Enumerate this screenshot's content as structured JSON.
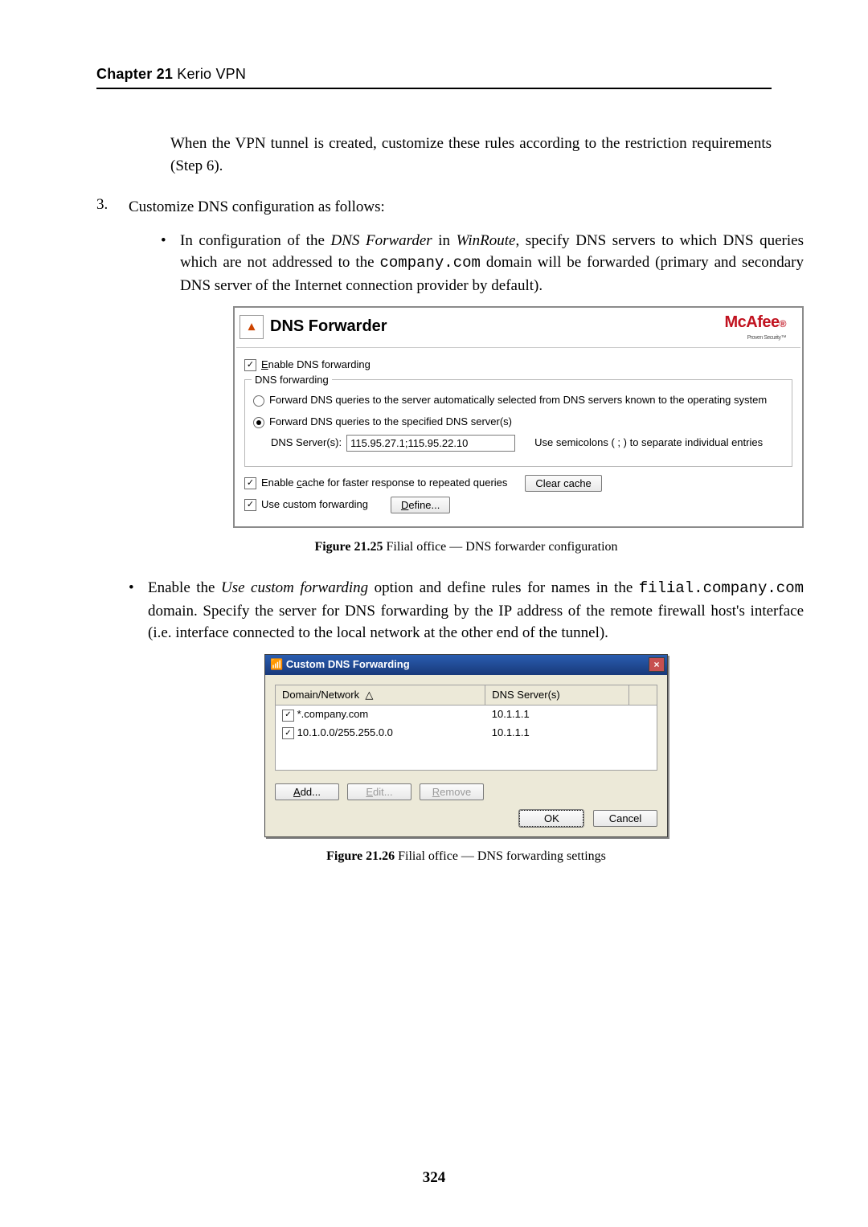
{
  "header": {
    "chapter": "Chapter 21",
    "title": "Kerio VPN"
  },
  "para1": "When the VPN tunnel is created, customize these rules according to the restriction requirements (Step 6).",
  "step3": {
    "num": "3.",
    "text": "Customize DNS configuration as follows:",
    "bullet1_a": "In configuration of the ",
    "bullet1_em1": "DNS Forwarder",
    "bullet1_b": " in ",
    "bullet1_em2": "WinRoute",
    "bullet1_c": ", specify DNS servers to which DNS queries which are not addressed to the ",
    "bullet1_code": "company.com",
    "bullet1_d": " domain will be forwarded (primary and secondary DNS server of the Internet connection provider by default)."
  },
  "fig1": {
    "title": "DNS Forwarder",
    "brand": "McAfee",
    "brand_sub": "Proven Security™",
    "enable_label": "Enable DNS forwarding",
    "enable_checked": "✓",
    "group_legend": "DNS forwarding",
    "radio1": "Forward DNS queries to the server automatically selected from DNS servers known to the operating system",
    "radio2": "Forward DNS queries to the specified DNS server(s)",
    "servers_label": "DNS Server(s):",
    "servers_value": "115.95.27.1;115.95.22.10",
    "servers_hint": "Use semicolons ( ; ) to separate individual entries",
    "cache_label": "Enable cache for faster response to repeated queries",
    "cache_checked": "✓",
    "clear_btn": "Clear cache",
    "custom_label": "Use custom forwarding",
    "custom_checked": "✓",
    "define_btn": "Define..."
  },
  "caption1_bold": "Figure 21.25",
  "caption1_rest": "   Filial office — DNS forwarder configuration",
  "bullet2": {
    "a": "Enable the ",
    "em": "Use custom forwarding",
    "b": " option and define rules for names in the ",
    "code": "filial.company.com",
    "c": " domain.  Specify the server for DNS forwarding by the IP address of the remote firewall host's interface (i.e. interface connected to the local network at the other end of the tunnel)."
  },
  "fig2": {
    "title": "Custom DNS Forwarding",
    "col1": "Domain/Network",
    "col2": "DNS Server(s)",
    "rows": [
      {
        "checked": "✓",
        "domain": "*.company.com",
        "server": "10.1.1.1"
      },
      {
        "checked": "✓",
        "domain": "10.1.0.0/255.255.0.0",
        "server": "10.1.1.1"
      }
    ],
    "add": "Add...",
    "edit": "Edit...",
    "remove": "Remove",
    "ok": "OK",
    "cancel": "Cancel"
  },
  "caption2_bold": "Figure 21.26",
  "caption2_rest": "   Filial office — DNS forwarding settings",
  "pagenum": "324"
}
